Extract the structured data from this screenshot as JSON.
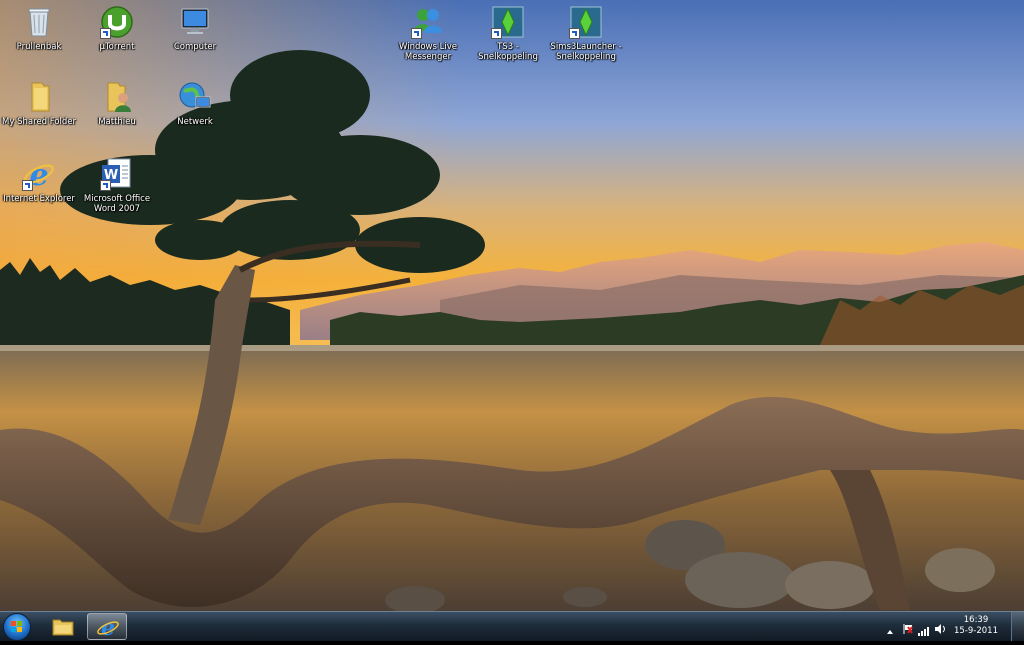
{
  "desktop": {
    "icons": [
      {
        "label": "Prullenbak",
        "icon": "recycle-bin-icon"
      },
      {
        "label": "µTorrent",
        "icon": "utorrent-icon"
      },
      {
        "label": "Computer",
        "icon": "computer-icon"
      },
      {
        "label": "Windows Live Messenger",
        "icon": "messenger-icon"
      },
      {
        "label": "TS3 - Snelkoppeling",
        "icon": "sims3-icon"
      },
      {
        "label": "Sims3Launcher - Snelkoppeling",
        "icon": "sims3-launcher-icon"
      },
      {
        "label": "My Shared Folder",
        "icon": "folder-icon"
      },
      {
        "label": "Matthieu",
        "icon": "user-folder-icon"
      },
      {
        "label": "Netwerk",
        "icon": "network-icon"
      },
      {
        "label": "Internet Explorer",
        "icon": "internet-explorer-icon"
      },
      {
        "label": "Microsoft Office Word 2007",
        "icon": "word-icon"
      }
    ]
  },
  "taskbar": {
    "start_icon": "windows-start-icon",
    "pinned": [
      {
        "icon": "explorer-folder-icon"
      },
      {
        "icon": "internet-explorer-icon",
        "active": true
      }
    ],
    "tray": {
      "icons": [
        "show-hidden-icons-chevron",
        "action-center-flag-icon",
        "network-signal-icon",
        "volume-icon"
      ]
    },
    "clock": {
      "time": "16:39",
      "date": "15-9-2011"
    }
  },
  "colors": {
    "sky_top": "#5b82c4",
    "sunset": "#f2b44a",
    "water": "#b98a3c",
    "taskbar": "#1f2d3b"
  }
}
